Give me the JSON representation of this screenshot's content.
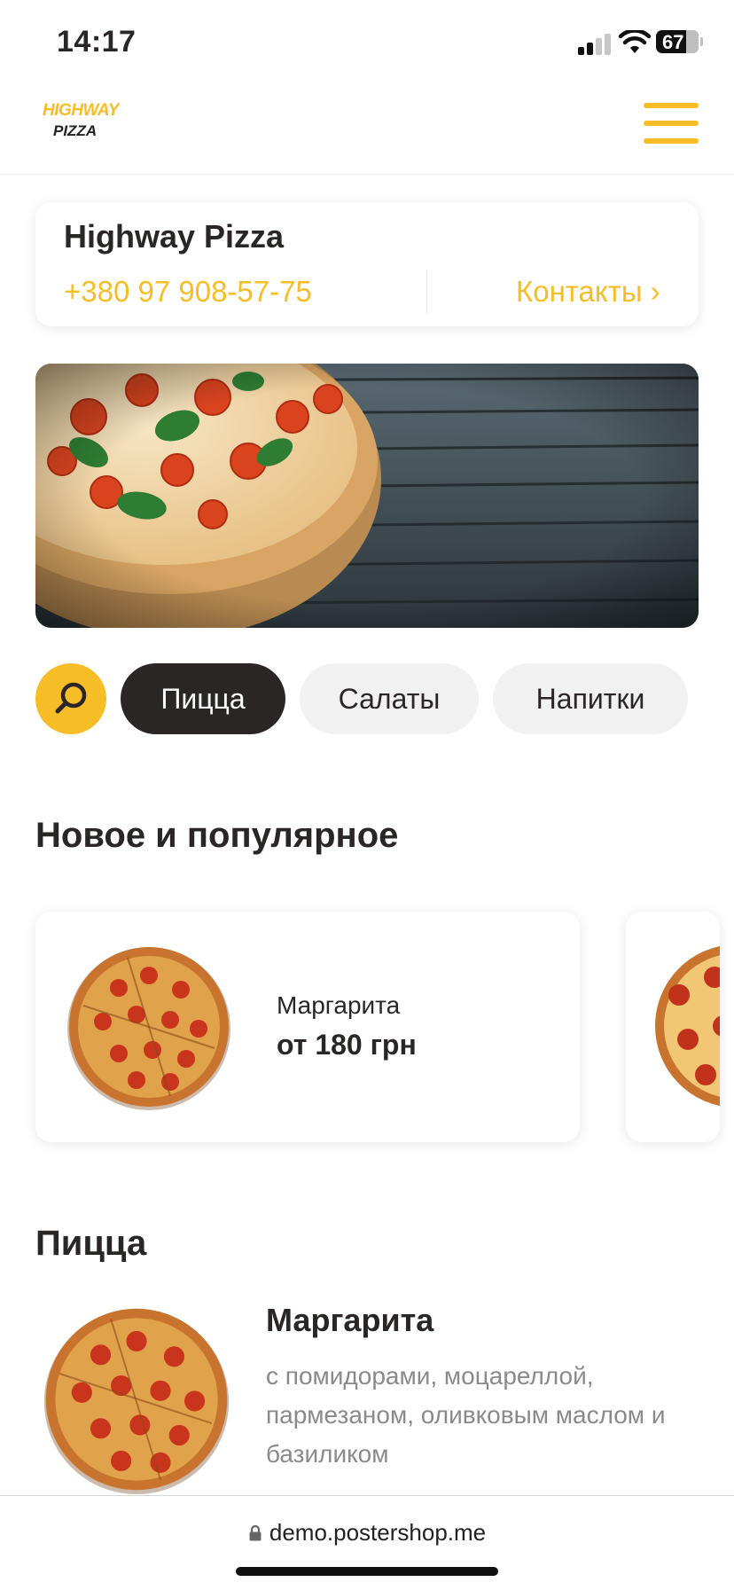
{
  "status_bar": {
    "time": "14:17",
    "battery": "67"
  },
  "header": {
    "logo_line1": "HIGHWAY",
    "logo_line2": "PIZZA"
  },
  "info_card": {
    "name": "Highway Pizza",
    "phone": "+380 97 908-57-75",
    "contacts": "Контакты ›"
  },
  "categories": [
    {
      "label": "Пицца",
      "active": true
    },
    {
      "label": "Салаты",
      "active": false
    },
    {
      "label": "Напитки",
      "active": false
    }
  ],
  "popular": {
    "title": "Новое и популярное",
    "items": [
      {
        "name": "Маргарита",
        "price": "от 180 грн"
      }
    ]
  },
  "pizza_section": {
    "title": "Пицца",
    "items": [
      {
        "name": "Маргарита",
        "description": "с помидорами, моцареллой, пармезаном, оливковым маслом и базиликом"
      }
    ]
  },
  "browser": {
    "url": "demo.postershop.me"
  },
  "colors": {
    "accent": "#f6bd26",
    "dark": "#2a2626",
    "muted": "#8a8a8a"
  }
}
